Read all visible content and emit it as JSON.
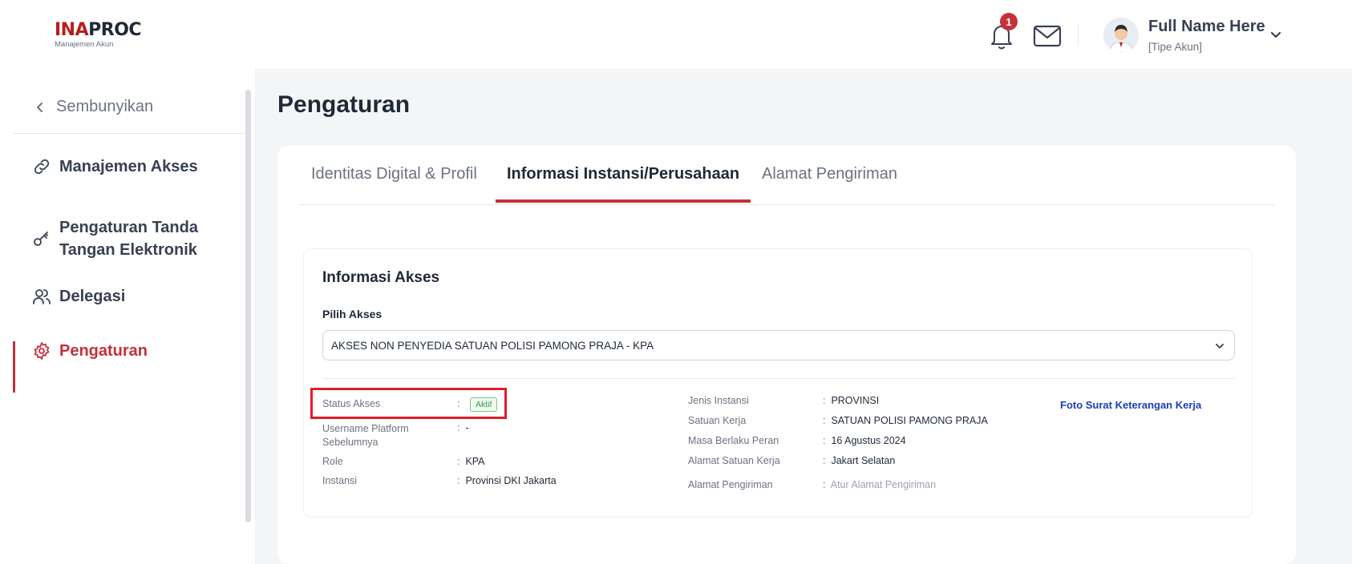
{
  "header": {
    "logo_part1": "INA",
    "logo_part2": "PROC",
    "logo_subtitle": "Manajemen Akun",
    "notification_count": "1",
    "user_name": "Full Name Here",
    "user_type": "[Tipe Akun]"
  },
  "sidebar": {
    "collapse_label": "Sembunyikan",
    "items": [
      {
        "label": "Manajemen Akses",
        "icon": "link-icon"
      },
      {
        "label_line1": "Pengaturan Tanda",
        "label_line2": "Tangan Elektronik",
        "icon": "key-icon"
      },
      {
        "label": "Delegasi",
        "icon": "users-icon"
      },
      {
        "label": "Pengaturan",
        "icon": "gear-icon",
        "active": true
      }
    ]
  },
  "main": {
    "page_title": "Pengaturan",
    "tabs": [
      {
        "label": "Identitas Digital & Profil"
      },
      {
        "label": "Informasi Instansi/Perusahaan",
        "active": true
      },
      {
        "label": "Alamat Pengiriman"
      }
    ],
    "section": {
      "title": "Informasi Akses",
      "select_label": "Pilih Akses",
      "select_value": "AKSES NON PENYEDIA SATUAN POLISI PAMONG PRAJA - KPA",
      "left": {
        "status_label": "Status Akses",
        "status_value": "Aktif",
        "username_label_line1": "Username Platform",
        "username_label_line2": "Sebelumnya",
        "username_value": "-",
        "role_label": "Role",
        "role_value": "KPA",
        "instansi_label": "Instansi",
        "instansi_value": "Provinsi DKI Jakarta"
      },
      "right": {
        "jenis_label": "Jenis Instansi",
        "jenis_value": "PROVINSI",
        "satker_label": "Satuan Kerja",
        "satker_value": "SATUAN POLISI PAMONG PRAJA",
        "masa_label": "Masa Berlaku Peran",
        "masa_value": "16 Agustus 2024",
        "alamat_satker_label": "Alamat Satuan Kerja",
        "alamat_satker_value": "Jakart Selatan",
        "alamat_kirim_label": "Alamat Pengiriman",
        "alamat_kirim_value": "Atur Alamat Pengiriman"
      },
      "separator": ":",
      "link": "Foto Surat Keterangan Kerja"
    }
  },
  "colors": {
    "brand_red": "#c5303b",
    "link_blue": "#1d3fb8",
    "status_green": "#2f9e44",
    "highlight_red": "#e11d2a"
  }
}
